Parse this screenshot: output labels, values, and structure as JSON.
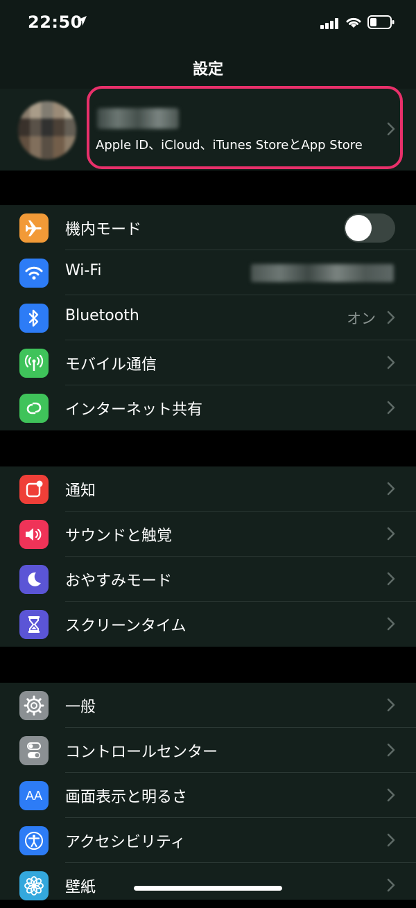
{
  "status_bar": {
    "time": "22:50"
  },
  "nav": {
    "title": "設定"
  },
  "profile": {
    "subtitle": "Apple ID、iCloud、iTunes StoreとApp Store"
  },
  "groups": [
    {
      "items": [
        {
          "label": "機内モード",
          "icon": "airplane-icon",
          "color": "#f29a37"
        },
        {
          "label": "Wi-Fi",
          "icon": "wifi-icon",
          "color": "#2d7cf6"
        },
        {
          "label": "Bluetooth",
          "icon": "bluetooth-icon",
          "color": "#2d7cf6",
          "value": "オン"
        },
        {
          "label": "モバイル通信",
          "icon": "antenna-icon",
          "color": "#3fc35a"
        },
        {
          "label": "インターネット共有",
          "icon": "link-icon",
          "color": "#3fc35a"
        }
      ]
    },
    {
      "items": [
        {
          "label": "通知",
          "icon": "notification-icon",
          "color": "#ef3f38"
        },
        {
          "label": "サウンドと触覚",
          "icon": "speaker-icon",
          "color": "#ef3358"
        },
        {
          "label": "おやすみモード",
          "icon": "moon-icon",
          "color": "#5b55d6"
        },
        {
          "label": "スクリーンタイム",
          "icon": "hourglass-icon",
          "color": "#5b55d6"
        }
      ]
    },
    {
      "items": [
        {
          "label": "一般",
          "icon": "gear-icon",
          "color": "#8b9093"
        },
        {
          "label": "コントロールセンター",
          "icon": "switches-icon",
          "color": "#8b9093"
        },
        {
          "label": "画面表示と明るさ",
          "icon": "text-size-icon",
          "color": "#2d7cf6",
          "text": "AA"
        },
        {
          "label": "アクセシビリティ",
          "icon": "accessibility-icon",
          "color": "#2d7cf6"
        },
        {
          "label": "壁紙",
          "icon": "flower-icon",
          "color": "#34a8dd"
        }
      ]
    }
  ],
  "airplane_toggle": {
    "on": false
  }
}
